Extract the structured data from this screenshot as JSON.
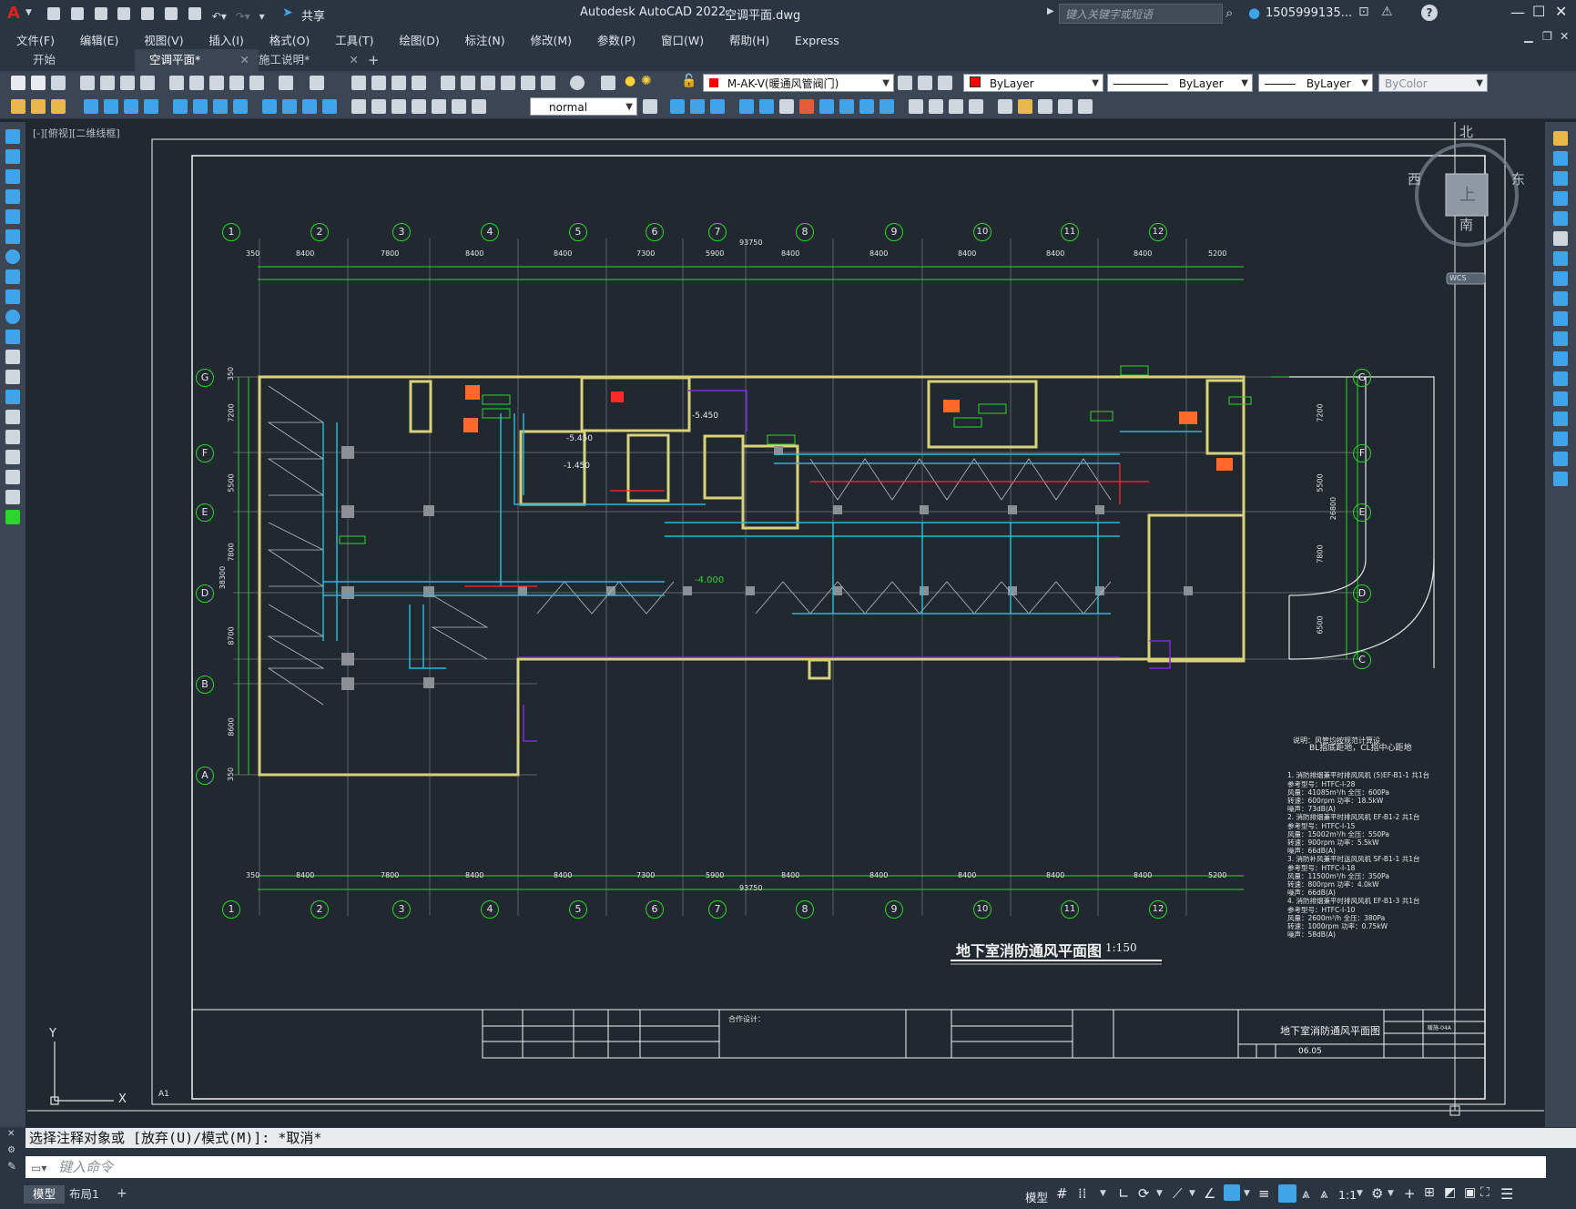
{
  "app": {
    "title": "Autodesk AutoCAD 2022",
    "document": "空调平面.dwg",
    "share_label": "共享",
    "search_placeholder": "键入关键字或短语",
    "user": "1505999135...",
    "help_symbol": "?"
  },
  "menu": [
    "文件(F)",
    "编辑(E)",
    "视图(V)",
    "插入(I)",
    "格式(O)",
    "工具(T)",
    "绘图(D)",
    "标注(N)",
    "修改(M)",
    "参数(P)",
    "窗口(W)",
    "帮助(H)",
    "Express"
  ],
  "tabs": [
    {
      "label": "开始",
      "active": false
    },
    {
      "label": "空调平面*",
      "active": true
    },
    {
      "label": "施工说明*",
      "active": false
    }
  ],
  "toolbar": {
    "layer": "M-AK-V(暖通风管阀门)",
    "color": "ByLayer",
    "linetype": "ByLayer",
    "lineweight": "ByLayer",
    "plotstyle": "ByColor",
    "dimstyle": "normal",
    "layer_color": "#ff0000"
  },
  "viewport_label": "[-][俯视][二维线框]",
  "viewcube": {
    "north": "北",
    "south": "南",
    "east": "东",
    "west": "西",
    "top": "上",
    "wcs": "WCS"
  },
  "ucs": {
    "x": "X",
    "y": "Y"
  },
  "drawing": {
    "title": "地下室消防通风平面图",
    "scale": "1:150",
    "grid_cols": [
      "1",
      "2",
      "3",
      "4",
      "5",
      "6",
      "7",
      "8",
      "9",
      "10",
      "11",
      "12"
    ],
    "grid_rows": [
      "G",
      "F",
      "E",
      "D",
      "B",
      "A",
      "C"
    ],
    "dims_top": [
      "350",
      "8400",
      "7800",
      "8400",
      "8400",
      "7300",
      "5900",
      "8400",
      "8400",
      "8400",
      "8400",
      "8400",
      "5200"
    ],
    "total_dim": "93750",
    "elev_1": "-4.000",
    "elev_2": "-5.450",
    "elev_3": "-1.450",
    "dims_left": [
      "350",
      "7200",
      "5500",
      "7800",
      "38300",
      "8700",
      "8600",
      "350"
    ],
    "dims_right": [
      "7200",
      "5500",
      "26800",
      "7800",
      "6500"
    ],
    "sheet_mark": "A1",
    "notes_title": "说明：风管均按规范计算设",
    "notes_sub": "BL指底距地，CL指中心距地",
    "notes": [
      "1. 消防排烟兼平时排风风机  (5)EF-B1-1   共1台",
      "   参考型号：HTFC-I-28",
      "   风量：41085m³/h   全压：600Pa",
      "   转速：600rpm   功率：18.5kW",
      "   噪声：73dB(A)",
      "2. 消防排烟兼平时排风风机  EF-B1-2   共1台",
      "   参考型号：HTFC-I-15",
      "   风量：15002m³/h   全压：550Pa",
      "   转速：900rpm   功率：5.5kW",
      "   噪声：66dB(A)",
      "3. 消防补风兼平时送风风机  SF-B1-1   共1台",
      "   参考型号：HTFC-I-18",
      "   风量：11500m³/h   全压：350Pa",
      "   转速：800rpm   功率：4.0kW",
      "   噪声：66dB(A)",
      "4. 消防排烟兼平时排风风机  EF-B1-3   共1台",
      "   参考型号：HTFC-I-10",
      "   风量：2600m³/h   全压：380Pa",
      "   转速：1000rpm   功率：0.75kW",
      "   噪声：58dB(A)"
    ],
    "titleblock": {
      "drawing_name": "地下室消防通风平面图",
      "drawing_no": "06.05",
      "cooperative": "合作设计：",
      "sheet_no": "暖施-04A"
    }
  },
  "command": {
    "history": "选择注释对象或 [放弃(U)/模式(M)]: *取消*",
    "placeholder": "键入命令"
  },
  "status": {
    "tabs": [
      {
        "label": "模型",
        "active": true
      },
      {
        "label": "布局1",
        "active": false
      }
    ],
    "model_label": "模型",
    "scale": "1:1"
  },
  "colors": {
    "wall": "#d8d27a",
    "grid": "#2bd62b",
    "duct": "#29b8d8",
    "fire": "#ff2a2a",
    "accent": "#7a2cd6"
  }
}
